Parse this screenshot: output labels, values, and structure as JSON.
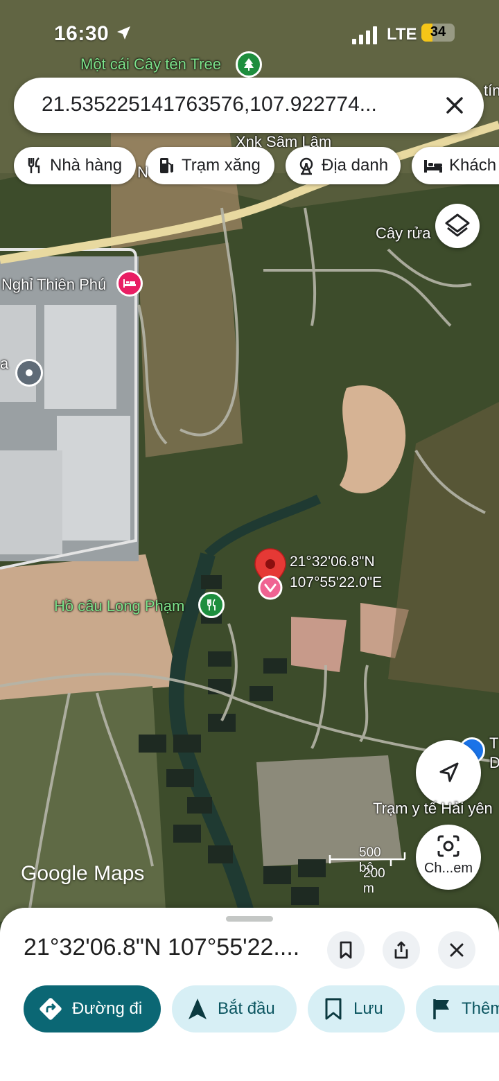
{
  "status_bar": {
    "time": "16:30",
    "network": "LTE",
    "battery": "34",
    "battery_level": 0.34
  },
  "search": {
    "query": "21.535225141763576,107.922774..."
  },
  "chips": [
    {
      "label": "Nhà hàng",
      "icon": "fork-knife-icon"
    },
    {
      "label": "Trạm xăng",
      "icon": "gas-pump-icon"
    },
    {
      "label": "Địa danh",
      "icon": "ferris-wheel-icon"
    },
    {
      "label": "Khách",
      "icon": "bed-icon"
    }
  ],
  "map_labels": {
    "tree": "Một cái Cây tên Tree",
    "xnk": "Xnk Sâm Lâm",
    "cay_rua": "Cây rửa",
    "nghi": "Nghỉ Thiên Phú",
    "ho_cau": "Hồ câu Long Phạm",
    "tram_y_te": "Trạm y tế Hải yên",
    "edge_tin": "tín",
    "edge_n": "N",
    "edge_a": "a",
    "edge_td_1": "T",
    "edge_td_2": "D"
  },
  "pin": {
    "lat": "21°32'06.8\"N",
    "lng": "107°55'22.0\"E"
  },
  "scale": {
    "imperial": "500 bộ",
    "metric": "200 m"
  },
  "brand": "Google Maps",
  "lens_label": "Ch...em",
  "sheet": {
    "title": "21°32'06.8\"N 107°55'22...."
  },
  "actions": [
    {
      "label": "Đường đi",
      "icon": "directions-icon"
    },
    {
      "label": "Bắt đầu",
      "icon": "navigation-arrow-icon"
    },
    {
      "label": "Lưu",
      "icon": "bookmark-icon"
    },
    {
      "label": "Thêm",
      "icon": "flag-icon"
    }
  ],
  "colors": {
    "primary_action": "#0b6774",
    "secondary_action": "#d7eff5",
    "pin": "#e53935",
    "road": "#e8d9a0"
  }
}
